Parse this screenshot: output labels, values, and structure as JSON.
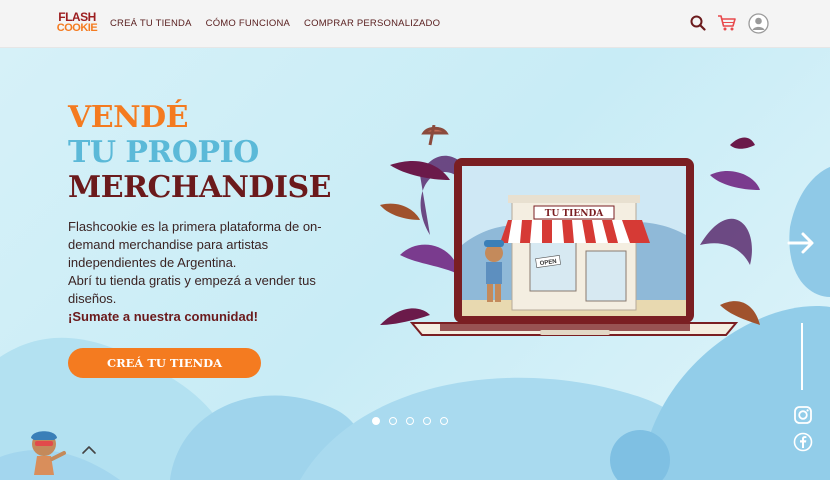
{
  "brand": {
    "line1": "FLASH",
    "line2": "COOKIE"
  },
  "nav": {
    "items": [
      "CREÁ TU TIENDA",
      "CÓMO FUNCIONA",
      "COMPRAR PERSONALIZADO"
    ]
  },
  "icons": {
    "search": "search-icon",
    "cart": "cart-icon",
    "account": "user-icon",
    "next": "arrow-right-icon",
    "scroll_top": "chevron-up-icon",
    "instagram": "instagram-icon",
    "facebook": "facebook-icon"
  },
  "hero": {
    "title": [
      "VENDÉ",
      "TU PROPIO",
      "MERCHANDISE"
    ],
    "description": "Flashcookie es la primera plataforma de on-demand merchandise para artistas independientes de Argentina.",
    "description2": "Abrí tu tienda gratis y empezá a vender tus diseños.",
    "highlight": "¡Sumate a nuestra comunidad!",
    "cta": "CREÁ TU TIENDA",
    "store_sign": "TU TIENDA",
    "open_sign": "OPEN"
  },
  "carousel": {
    "slides": 5,
    "active": 1
  },
  "colors": {
    "orange": "#f47b20",
    "blue": "#5bb9d8",
    "maroon": "#6b1a1c",
    "background": "#cfeef7"
  }
}
